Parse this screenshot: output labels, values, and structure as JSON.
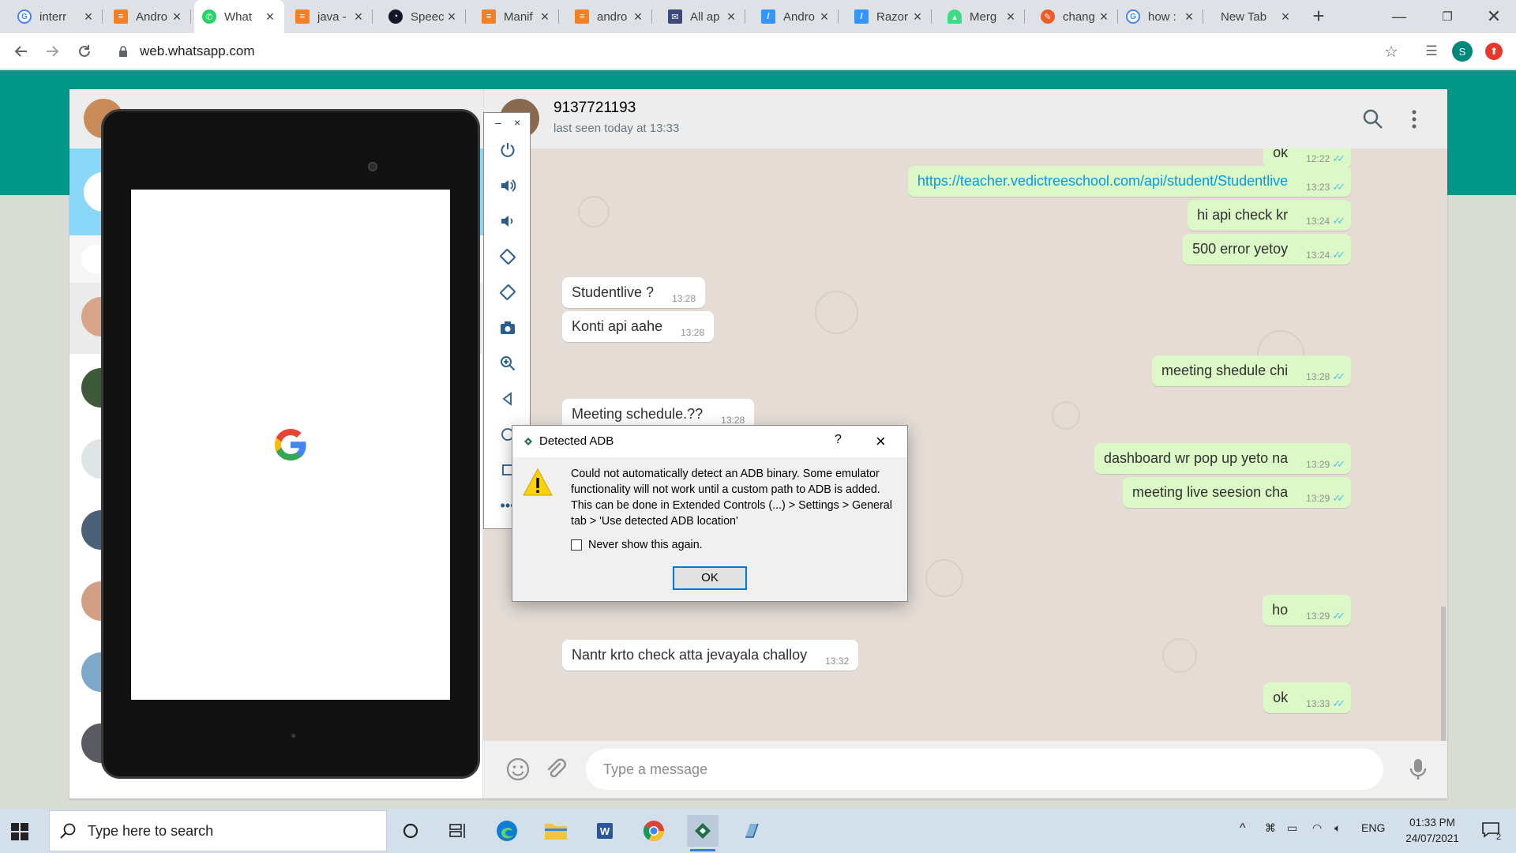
{
  "browser": {
    "tabs": [
      {
        "label": "interr",
        "icon": "google-icon",
        "color": "#4285f4"
      },
      {
        "label": "Andro",
        "icon": "stackoverflow-icon",
        "color": "#f48024"
      },
      {
        "label": "What",
        "icon": "whatsapp-icon",
        "color": "#25d366",
        "active": true
      },
      {
        "label": "java -",
        "icon": "stackoverflow-icon",
        "color": "#f48024"
      },
      {
        "label": "Speec",
        "icon": "speedtest-icon",
        "color": "#141526"
      },
      {
        "label": "Manif",
        "icon": "stackoverflow-icon",
        "color": "#f48024"
      },
      {
        "label": "andro",
        "icon": "stackoverflow-icon",
        "color": "#f48024"
      },
      {
        "label": "All ap",
        "icon": "gmail-icon",
        "color": "#3b4a7a"
      },
      {
        "label": "Andro",
        "icon": "razorpay-icon",
        "color": "#3395ff"
      },
      {
        "label": "Razor",
        "icon": "razorpay-icon",
        "color": "#3395ff"
      },
      {
        "label": "Merg",
        "icon": "android-icon",
        "color": "#3ddc84"
      },
      {
        "label": "chang",
        "icon": "postman-icon",
        "color": "#ef5b25"
      },
      {
        "label": "how :",
        "icon": "google-icon",
        "color": "#4285f4"
      },
      {
        "label": "New Tab",
        "icon": "",
        "color": "#ffffff"
      }
    ],
    "url": "web.whatsapp.com",
    "profile_initial": "S"
  },
  "chat": {
    "contact_name": "9137721193",
    "last_seen": "last seen today at 13:33",
    "compose_placeholder": "Type a message",
    "messages": [
      {
        "dir": "out",
        "text": "ok",
        "time": "12:22"
      },
      {
        "dir": "out",
        "text": "https://teacher.vedictreeschool.com/api/student/Studentlive",
        "time": "13:23",
        "link": true
      },
      {
        "dir": "out",
        "text": "hi api check kr",
        "time": "13:24"
      },
      {
        "dir": "out",
        "text": "500 error yetoy",
        "time": "13:24"
      },
      {
        "dir": "in",
        "text": "Studentlive ?",
        "time": "13:28"
      },
      {
        "dir": "in",
        "text": "Konti api aahe",
        "time": "13:28"
      },
      {
        "dir": "out",
        "text": "meeting shedule chi",
        "time": "13:28"
      },
      {
        "dir": "in",
        "text": "Meeting schedule.??",
        "time": "13:28"
      },
      {
        "dir": "out",
        "text": "dashboard wr pop up yeto na",
        "time": "13:29"
      },
      {
        "dir": "out",
        "text": "meeting live seesion cha",
        "time": "13:29"
      },
      {
        "dir": "out",
        "text": "ho",
        "time": "13:29"
      },
      {
        "dir": "in",
        "text": "Nantr krto check atta jevayala challoy",
        "time": "13:32"
      },
      {
        "dir": "out",
        "text": "ok",
        "time": "13:33"
      }
    ]
  },
  "dialog": {
    "title": "Detected ADB",
    "help": "?",
    "message": "Could not automatically detect an ADB binary. Some emulator functionality will not work until a custom path to ADB  is added. This can be done in Extended Controls (...) > Settings > General tab > 'Use detected ADB location'",
    "checkbox_label": "Never show this again.",
    "ok_label": "OK"
  },
  "taskbar": {
    "search_placeholder": "Type here to search",
    "language": "ENG",
    "time": "01:33 PM",
    "date": "24/07/2021",
    "notification_count": "2"
  },
  "colors": {
    "wa_header_green": "#009688",
    "outgoing_bubble": "#dcf8c6",
    "incoming_bubble": "#ffffff",
    "read_ticks": "#4fc3f7"
  }
}
